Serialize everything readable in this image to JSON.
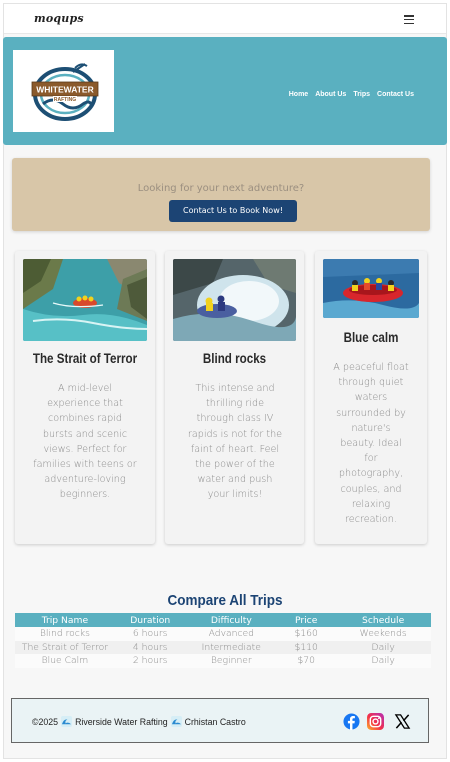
{
  "topbar": {
    "logo": "moqups"
  },
  "header": {
    "brand_line1": "WHITEWATER",
    "brand_line2": "RAFTING",
    "nav": [
      "Home",
      "About Us",
      "Trips",
      "Contact Us"
    ]
  },
  "cta": {
    "text": "Looking for your next adventure?",
    "button": "Contact Us to Book Now!"
  },
  "trips": [
    {
      "title": "The Strait of Terror",
      "description": "A mid-level experience that combines rapid bursts and scenic views. Perfect for families with teens or adventure-loving beginners."
    },
    {
      "title": "Blind rocks",
      "description": "This intense and thrilling ride through class IV rapids is not for the faint of heart. Feel the power of the water and push your limits!"
    },
    {
      "title": "Blue calm",
      "description": "A peaceful float through quiet waters surrounded by nature's beauty. Ideal for photography, couples, and relaxing recreation."
    }
  ],
  "compare": {
    "title": "Compare All Trips",
    "headers": [
      "Trip Name",
      "Duration",
      "Difficulty",
      "Price",
      "Schedule"
    ],
    "rows": [
      [
        "Blind rocks",
        "6 hours",
        "Advanced",
        "$160",
        "Weekends"
      ],
      [
        "The Strait of Terror",
        "4 hours",
        "Intermediate",
        "$110",
        "Daily"
      ],
      [
        "Blue Calm",
        "2 hours",
        "Beginner",
        "$70",
        "Daily"
      ]
    ]
  },
  "footer": {
    "copyright": "©2025",
    "company": "Riverside Water Rafting",
    "author": "Crhistan Castro",
    "icons": [
      "facebook-icon",
      "instagram-icon",
      "x-icon"
    ]
  },
  "colors": {
    "header_bg": "#5ab0c0",
    "cta_bg": "#d8c6a8",
    "button_bg": "#1c4474",
    "title_color": "#1c4474"
  }
}
